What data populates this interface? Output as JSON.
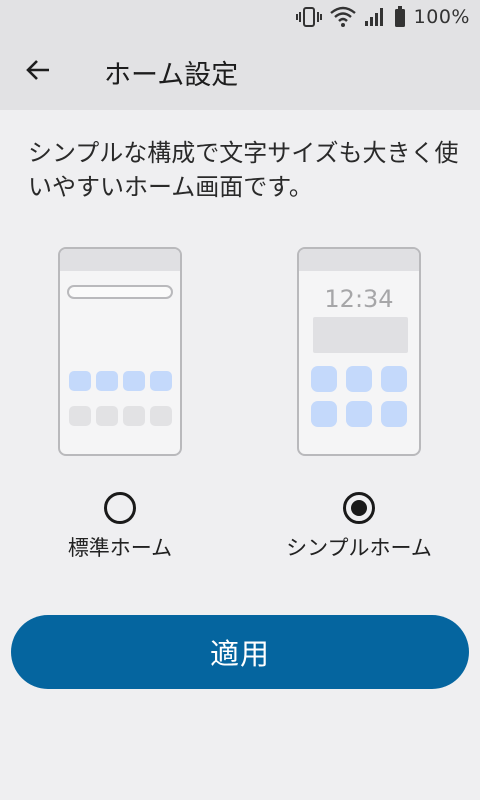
{
  "status_bar": {
    "battery_text": "100%",
    "icons": [
      "vibrate-icon",
      "wifi-icon",
      "signal-icon",
      "battery-icon"
    ]
  },
  "app_bar": {
    "back_icon": "arrow-left-icon",
    "title": "ホーム設定"
  },
  "description": "シンプルな構成で文字サイズも大きく使いやすいホーム画面です。",
  "options": [
    {
      "id": "standard",
      "label": "標準ホーム",
      "selected": false
    },
    {
      "id": "simple",
      "label": "シンプルホーム",
      "selected": true,
      "preview_clock": "12:34"
    }
  ],
  "apply_button": {
    "label": "適用"
  },
  "colors": {
    "primary": "#05659f",
    "app_bar_bg": "#e2e2e4",
    "page_bg": "#efeff1",
    "icon_tile": "#c4d9fb"
  }
}
